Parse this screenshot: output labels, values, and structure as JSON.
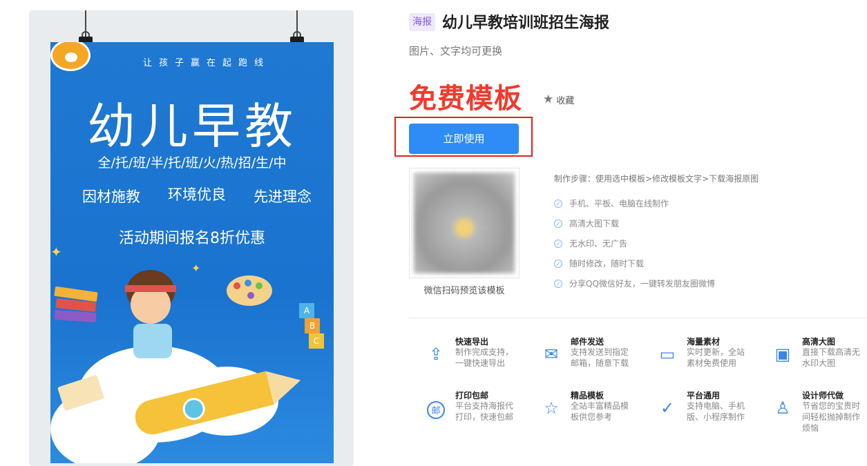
{
  "poster": {
    "slogan": "让孩子赢在起跑线",
    "headline": "幼儿早教",
    "types": "全/托/班/半/托/班/火/热/招/生/中",
    "features": [
      "因材施教",
      "环境优良",
      "先进理念"
    ],
    "promo": "活动期间报名8折优惠"
  },
  "info": {
    "tag": "海报",
    "title": "幼儿早教培训班招生海报",
    "subtitle": "图片、文字均可更换",
    "free_label": "免费模板",
    "favorite_label": "收藏",
    "use_button": "立即使用",
    "qr_label": "微信扫码预览该模板",
    "steps": "制作步骤：使用选中模板>修改模板文字>下载海报原图",
    "checks": [
      "手机、平板、电脑在线制作",
      "高清大图下载",
      "无水印、无广告",
      "随时修改，随时下载",
      "分享QQ微信好友，一键转发朋友圈微博"
    ]
  },
  "features": [
    {
      "title": "快速导出",
      "desc": "制作完成支持，一键快速导出",
      "icon": "export-icon"
    },
    {
      "title": "邮件发送",
      "desc": "支持发送到指定邮箱，随意下载",
      "icon": "mail-icon"
    },
    {
      "title": "海量素材",
      "desc": "实时更新，全站素材免费使用",
      "icon": "folder-icon"
    },
    {
      "title": "高清大图",
      "desc": "直接下载高清无水印大图",
      "icon": "image-icon"
    },
    {
      "title": "打印包邮",
      "desc": "平台支持海报代打印，快速包邮",
      "icon": "print-mail-icon",
      "glyph": "邮"
    },
    {
      "title": "精品模板",
      "desc": "全站丰富精品模板供您参考",
      "icon": "star-icon"
    },
    {
      "title": "平台通用",
      "desc": "支持电脑、手机版、小程序制作",
      "icon": "check-circle-icon"
    },
    {
      "title": "设计师代做",
      "desc": "节省您的宝贵时间轻松抛掉制作烦恼",
      "icon": "designer-icon"
    }
  ],
  "colors": {
    "accent": "#2f8bf5",
    "free": "#f03a2c",
    "poster_bg": "#1a73cf",
    "highlight_box": "#e02020"
  }
}
